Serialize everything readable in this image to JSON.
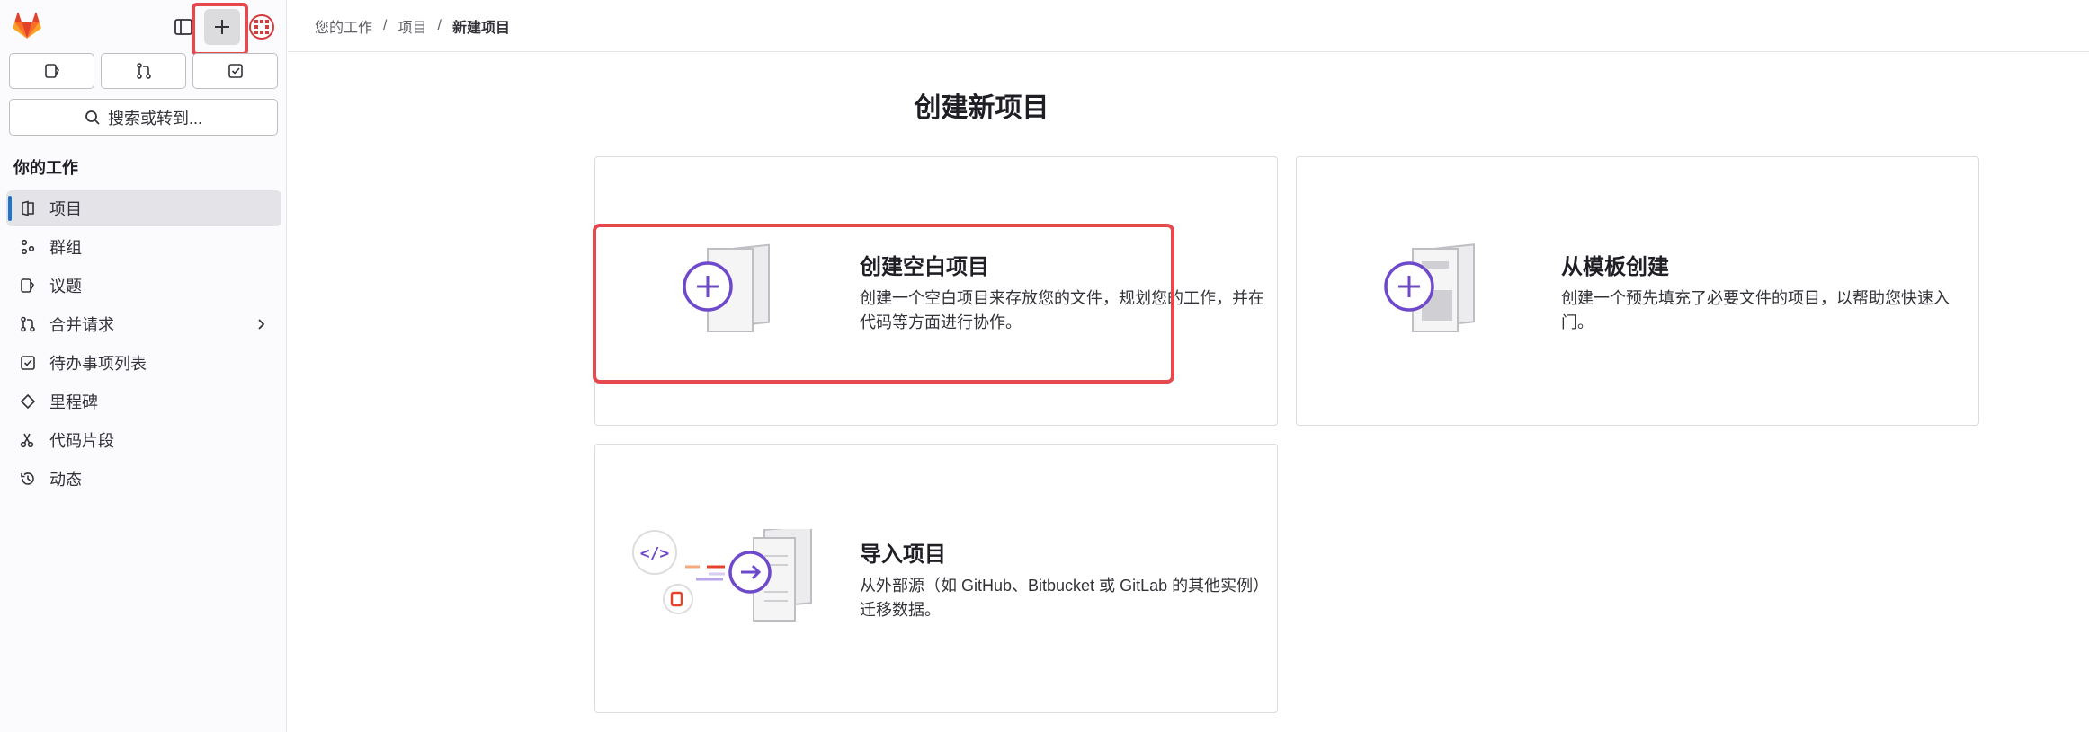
{
  "sidebar": {
    "search_label": "搜索或转到...",
    "section_title": "你的工作",
    "items": [
      {
        "label": "项目",
        "icon": "project-icon",
        "active": true
      },
      {
        "label": "群组",
        "icon": "group-icon"
      },
      {
        "label": "议题",
        "icon": "issues-icon"
      },
      {
        "label": "合并请求",
        "icon": "merge-request-icon",
        "has_chevron": true
      },
      {
        "label": "待办事项列表",
        "icon": "todo-icon"
      },
      {
        "label": "里程碑",
        "icon": "milestone-icon"
      },
      {
        "label": "代码片段",
        "icon": "snippet-icon"
      },
      {
        "label": "动态",
        "icon": "activity-icon"
      }
    ]
  },
  "breadcrumb": {
    "items": [
      "您的工作",
      "项目",
      "新建项目"
    ],
    "separator": "/"
  },
  "page": {
    "title": "创建新项目"
  },
  "cards": [
    {
      "title": "创建空白项目",
      "desc_line1": "创建一个空白项目来存放您的文件，规划您的工作，并在",
      "desc_line2": "代码等方面进行协作。"
    },
    {
      "title": "从模板创建",
      "desc_line1": "创建一个预先填充了必要文件的项目，以帮助您快速入",
      "desc_line2": "门。"
    },
    {
      "title": "导入项目",
      "desc_line1": "从外部源（如 GitHub、Bitbucket 或 GitLab 的其他实例）",
      "desc_line2": "迁移数据。"
    }
  ],
  "colors": {
    "accent_purple": "#6e49cb",
    "highlight_red": "#e5484d",
    "active_bar": "#1f75cb"
  }
}
